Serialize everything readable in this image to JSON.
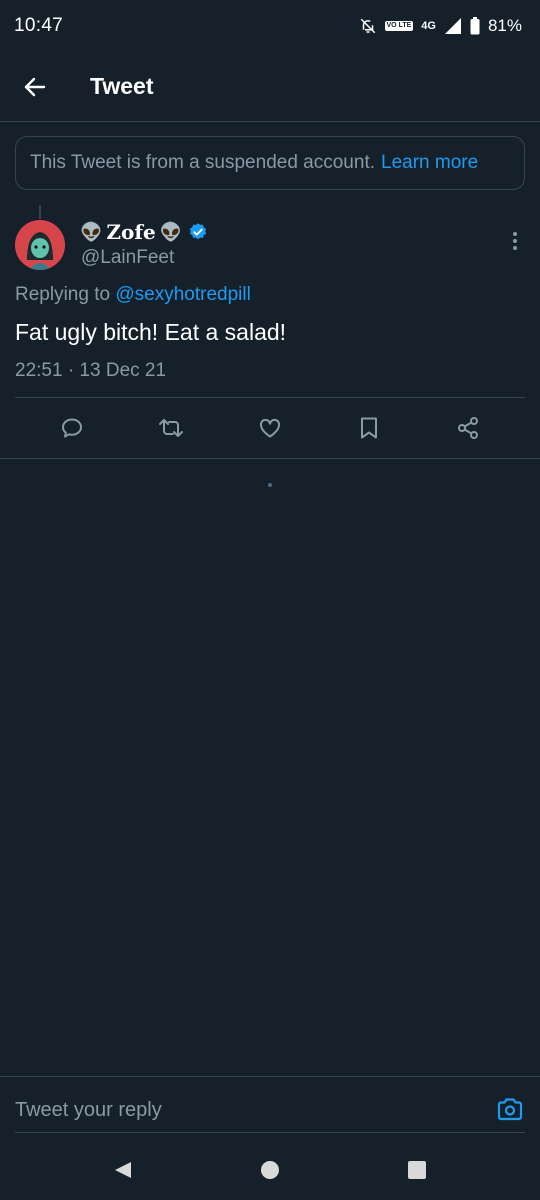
{
  "status_bar": {
    "time": "10:47",
    "volte_label": "VO LTE",
    "network_label": "4G",
    "battery": "81%",
    "icons": [
      "notifications-off-icon",
      "volte-icon",
      "network-4g-icon",
      "signal-icon",
      "battery-icon"
    ]
  },
  "header": {
    "title": "Tweet",
    "back_icon": "arrow-left-icon"
  },
  "banner": {
    "text": "This Tweet is from a suspended account.",
    "link": "Learn more"
  },
  "tweet": {
    "display_name": "Zofe",
    "name_emoji": "👽",
    "handle": "@LainFeet",
    "verified": true,
    "replying_prefix": "Replying to",
    "replying_to": "@sexyhotredpill",
    "text": "Fat ugly bitch! Eat a salad!",
    "timestamp": "22:51 · 13 Dec 21",
    "actions": [
      "reply-icon",
      "retweet-icon",
      "like-icon",
      "bookmark-icon",
      "share-icon"
    ]
  },
  "reply": {
    "placeholder": "Tweet your reply",
    "camera_icon": "camera-icon"
  },
  "nav": {
    "icons": [
      "back-triangle-icon",
      "home-circle-icon",
      "recents-square-icon"
    ]
  },
  "colors": {
    "background": "#15202b",
    "border": "#38444d",
    "accent": "#1d9bf0",
    "secondary_text": "#8b98a5",
    "primary_text": "#ffffff"
  }
}
